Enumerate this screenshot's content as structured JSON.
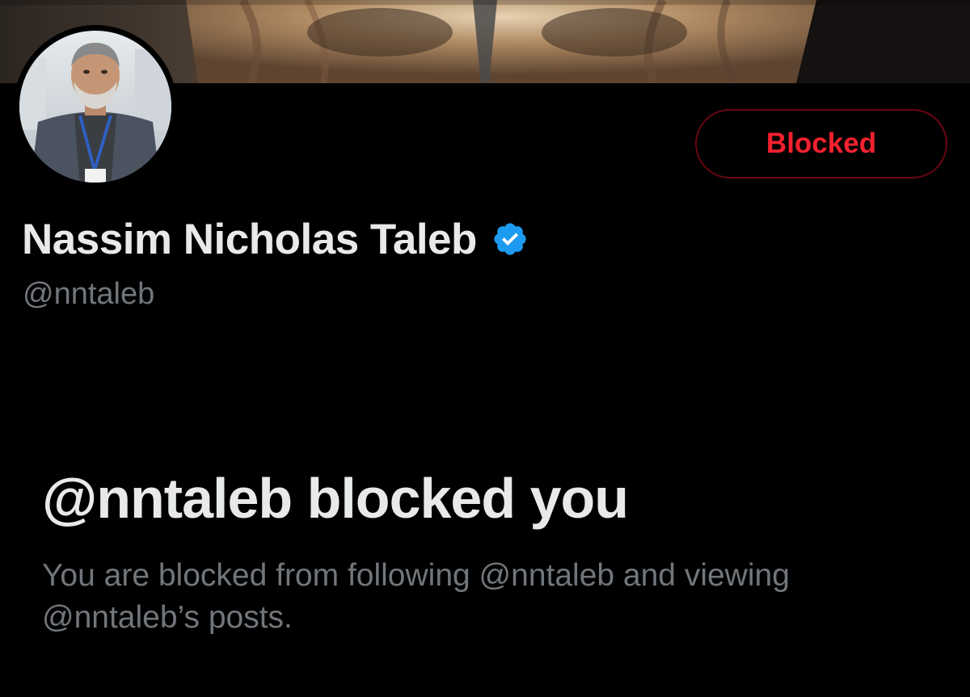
{
  "profile": {
    "display_name": "Nassim Nicholas Taleb",
    "handle": "@nntaleb",
    "verified": true,
    "verified_icon": "verified-badge-icon",
    "avatar_icon": "profile-photo",
    "banner_icon": "owl-banner-photo"
  },
  "actions": {
    "blocked_label": "Blocked"
  },
  "block_notice": {
    "title": "@nntaleb blocked you",
    "description": "You are blocked from following @nntaleb and viewing @nntaleb’s posts."
  },
  "colors": {
    "background": "#000000",
    "text_primary": "#e7e9ea",
    "text_secondary": "#71767b",
    "blocked_red": "#f4212e",
    "blocked_border": "#67070f",
    "verified_blue": "#1d9bf0"
  }
}
